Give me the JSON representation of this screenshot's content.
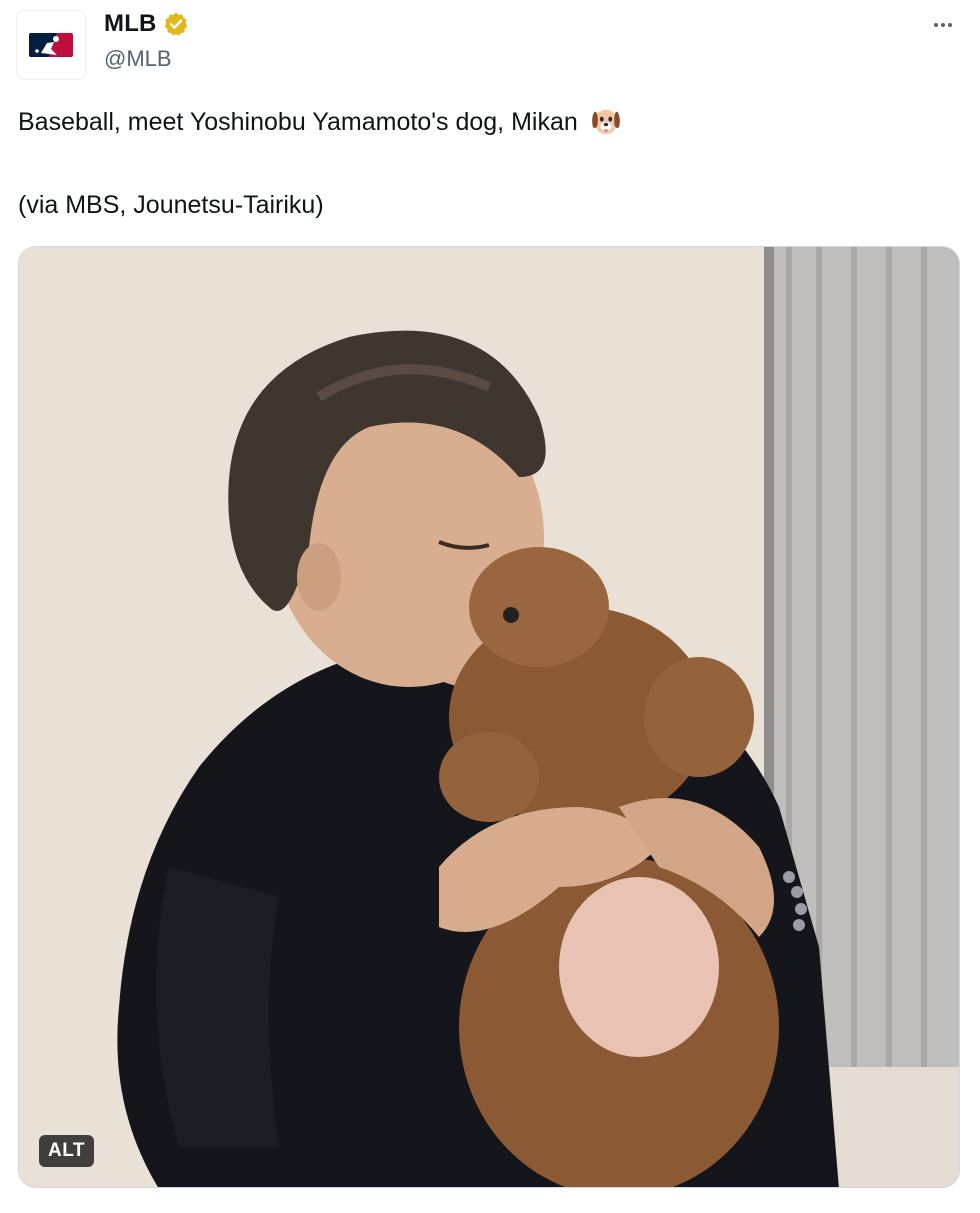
{
  "post": {
    "author": {
      "display_name": "MLB",
      "handle": "@MLB",
      "verified": true,
      "verified_badge_color": "#E2B719",
      "avatar_icon": "mlb-logo-icon"
    },
    "menu_icon": "more-options-icon",
    "text_line1": "Baseball, meet Yoshinobu Yamamoto's dog, Mikan",
    "text_emoji": "dog-face-emoji",
    "text_line2": "(via MBS, Jounetsu-Tairiku)",
    "media": {
      "alt_label": "ALT"
    }
  },
  "colors": {
    "text_primary": "#0F1419",
    "text_secondary": "#536471",
    "mlb_blue": "#041E42",
    "mlb_red": "#BF0D3E"
  }
}
